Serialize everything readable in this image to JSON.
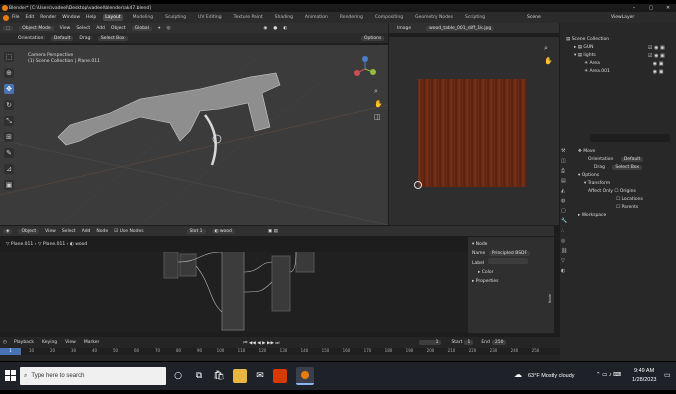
{
  "window": {
    "title": "Blender* [C:\\Users\\vadeel\\Desktop\\vadeel\\blender\\ak47.blend]"
  },
  "menubar": {
    "menus": [
      "File",
      "Edit",
      "Render",
      "Window",
      "Help"
    ],
    "workspaces": [
      "Layout",
      "Modeling",
      "Sculpting",
      "UV Editing",
      "Texture Paint",
      "Shading",
      "Animation",
      "Rendering",
      "Compositing",
      "Geometry Nodes",
      "Scripting"
    ],
    "active_workspace": "Layout",
    "scene_label": "Scene",
    "viewlayer_label": "ViewLayer"
  },
  "viewport": {
    "mode": "Object Mode",
    "menus": [
      "View",
      "Select",
      "Add",
      "Object"
    ],
    "transform": "Global",
    "orientation_label": "Orientation:",
    "orientation_value": "Default",
    "drag_label": "Drag:",
    "drag_value": "Select Box",
    "options": "Options",
    "overlay_line1": "Camera Perspective",
    "overlay_line2": "(1) Scene Collection | Plane.011",
    "tools": [
      "select-box",
      "cursor",
      "move",
      "rotate",
      "scale",
      "transform",
      "annotate",
      "measure",
      "add-cube"
    ]
  },
  "image_editor": {
    "mode": "Image",
    "filename": "wood_table_001_diff_1k.jpg"
  },
  "outliner": {
    "root": "Scene Collection",
    "items": [
      {
        "name": "GUN",
        "indent": 1
      },
      {
        "name": "lights",
        "indent": 1
      },
      {
        "name": "Area",
        "indent": 2
      },
      {
        "name": "Area.001",
        "indent": 2
      }
    ]
  },
  "properties": {
    "tool": "Move",
    "orientation_label": "Orientation",
    "orientation_value": "Default",
    "drag_label": "Drag",
    "drag_value": "Select Box",
    "options_section": "Options",
    "transform_section": "Transform",
    "affect_only": "Affect Only",
    "checks": [
      "Origins",
      "Locations",
      "Parents"
    ],
    "workspace_section": "Workspace"
  },
  "node_editor": {
    "object_mode": "Object",
    "menus": [
      "View",
      "Select",
      "Add",
      "Node"
    ],
    "use_nodes": "Use Nodes",
    "slot": "Slot 1",
    "material": "wood",
    "breadcrumb": [
      "Plane.011",
      "Plane.011",
      "wood"
    ]
  },
  "node_panel": {
    "section": "Node",
    "name_label": "Name",
    "name_value": "Principled BSDF",
    "label_label": "Label",
    "color_section": "Color",
    "properties_section": "Properties",
    "tabs": [
      "Node",
      "Tool",
      "View",
      "Options"
    ]
  },
  "timeline": {
    "playback": "Playback",
    "keying": "Keying",
    "view": "View",
    "marker": "Marker",
    "current_frame": "1",
    "start_label": "Start",
    "start": "1",
    "end_label": "End",
    "end": "250",
    "ticks": [
      "1",
      "10",
      "20",
      "30",
      "40",
      "50",
      "60",
      "70",
      "80",
      "90",
      "100",
      "110",
      "120",
      "130",
      "140",
      "150",
      "160",
      "170",
      "180",
      "190",
      "200",
      "210",
      "220",
      "230",
      "240",
      "250"
    ]
  },
  "taskbar": {
    "search_placeholder": "Type here to search",
    "weather": "63°F  Mostly cloudy",
    "time": "9:49 AM",
    "date": "1/28/2023"
  }
}
